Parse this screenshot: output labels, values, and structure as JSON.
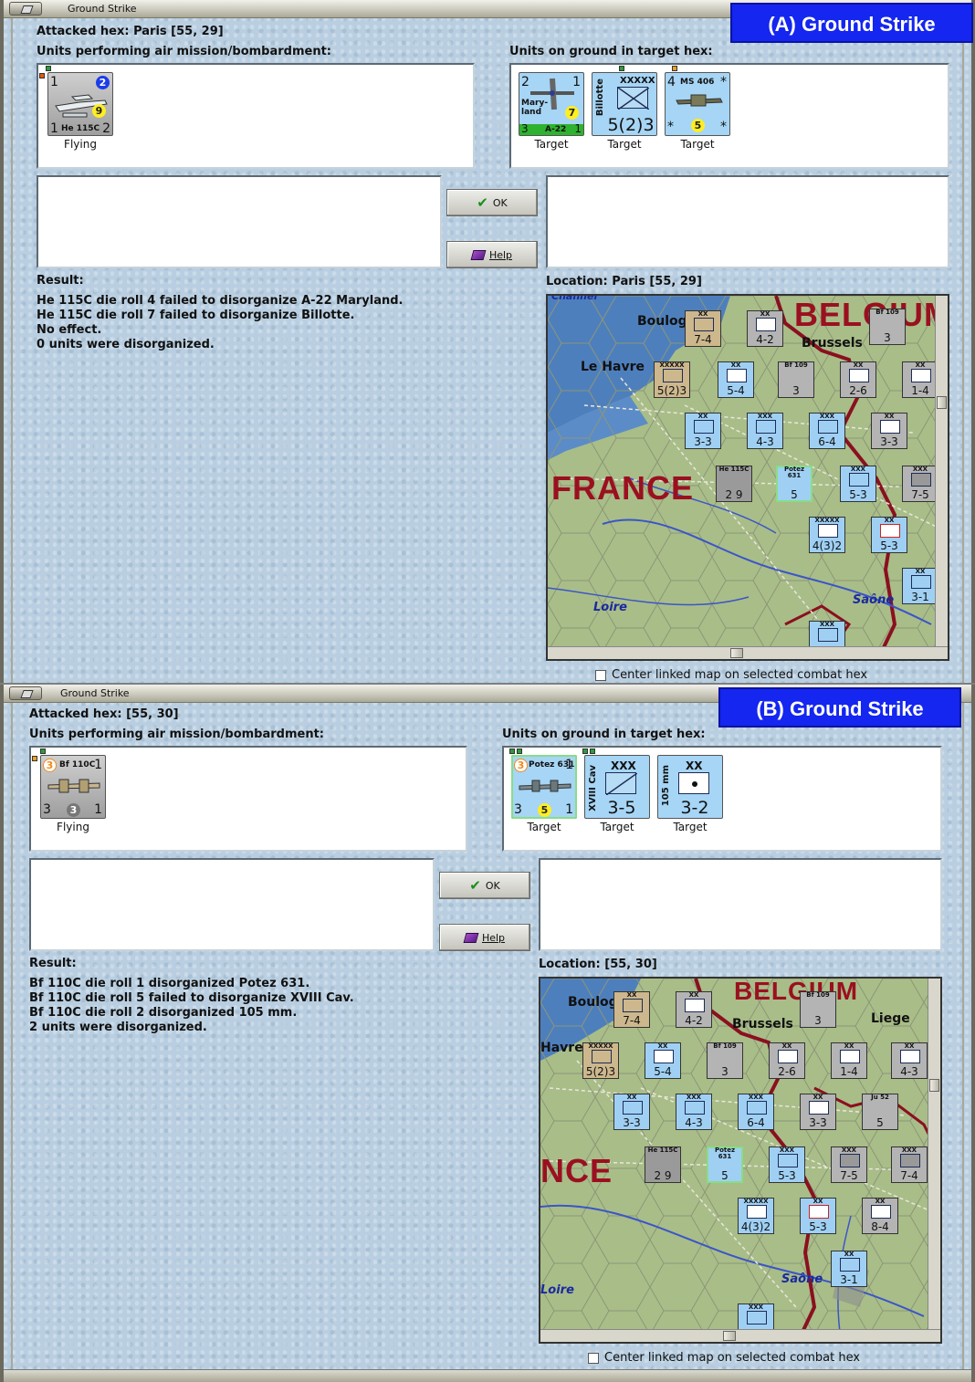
{
  "panels": [
    {
      "window_title": "Ground Strike",
      "badge": "(A)  Ground Strike",
      "attacked_hex": "Attacked hex: Paris  [55, 29]",
      "air_units_label": "Units performing air mission/bombardment:",
      "ground_units_label": "Units on ground in target hex:",
      "air_units": [
        {
          "name": "He 115C",
          "tl": "1",
          "tr": "2",
          "bl": "1",
          "br": "2",
          "circle": "9",
          "status": "Flying"
        }
      ],
      "ground_units": [
        {
          "name": "Mary-\nland",
          "sub": "A-22",
          "tl": "2",
          "tr": "1",
          "bl": "3",
          "br": "1",
          "circle": "7",
          "status": "Target"
        },
        {
          "name": "Billotte",
          "size": "XXXXX",
          "value": "5(2)3",
          "status": "Target"
        },
        {
          "name": "MS 406",
          "tl": "4",
          "tr": "*",
          "bl": "*",
          "br": "*",
          "circle": "5",
          "status": "Target"
        }
      ],
      "ok_label": "OK",
      "help_label": "Help",
      "result_label": "Result:",
      "result_lines": [
        "He 115C die roll 4 failed to disorganize A-22 Maryland.",
        "He 115C die roll 7 failed to disorganize Billotte.",
        "No effect.",
        "0 units were disorganized."
      ],
      "location": "Location:  Paris  [55, 29]",
      "map_labels": {
        "country1": "BELGIUM",
        "country2": "FRANCE",
        "city1": "Boulogne",
        "city2": "Le Havre",
        "city3": "Brussels",
        "river1": "Loire",
        "river2": "Saône",
        "sea": "Channel"
      },
      "center_checkbox": "Center linked map on selected combat hex"
    },
    {
      "window_title": "Ground Strike",
      "badge": "(B)  Ground Strike",
      "attacked_hex": "Attacked hex:  [55, 30]",
      "air_units_label": "Units performing air mission/bombardment:",
      "ground_units_label": "Units on ground in target hex:",
      "air_units": [
        {
          "name": "Bf 110C",
          "tl": "3",
          "tr": "1",
          "bl": "3",
          "br": "1",
          "circle": "3",
          "status": "Flying"
        }
      ],
      "ground_units": [
        {
          "name": "Potez 631",
          "tl": "3",
          "tr": "1",
          "bl": "3",
          "br": "1",
          "circle": "5",
          "status": "Target"
        },
        {
          "name": "XVIII Cav",
          "size": "XXX",
          "value": "3-5",
          "status": "Target"
        },
        {
          "name": "105 mm",
          "size": "XX",
          "value": "3-2",
          "status": "Target"
        }
      ],
      "ok_label": "OK",
      "help_label": "Help",
      "result_label": "Result:",
      "result_lines": [
        "Bf 110C die roll 1 disorganized Potez 631.",
        "Bf 110C die roll 5 failed to disorganize XVIII Cav.",
        "Bf 110C die roll 2 disorganized 105 mm.",
        "2 units were disorganized."
      ],
      "location": "Location:  [55, 30]",
      "map_labels": {
        "country1": "BELGIUM",
        "country2": "NCE",
        "city1": "Boulogne",
        "city2": "Havre",
        "city3": "Brussels",
        "city4": "Liege",
        "river1": "Saône",
        "river2": "Loire"
      },
      "center_checkbox": "Center linked map on selected combat hex"
    }
  ],
  "colors": {
    "badge": "#1426ef",
    "dialog_bg": "#b9cfe1",
    "border_red": "#8a1020",
    "counter_blue": "#a6d5f5"
  }
}
